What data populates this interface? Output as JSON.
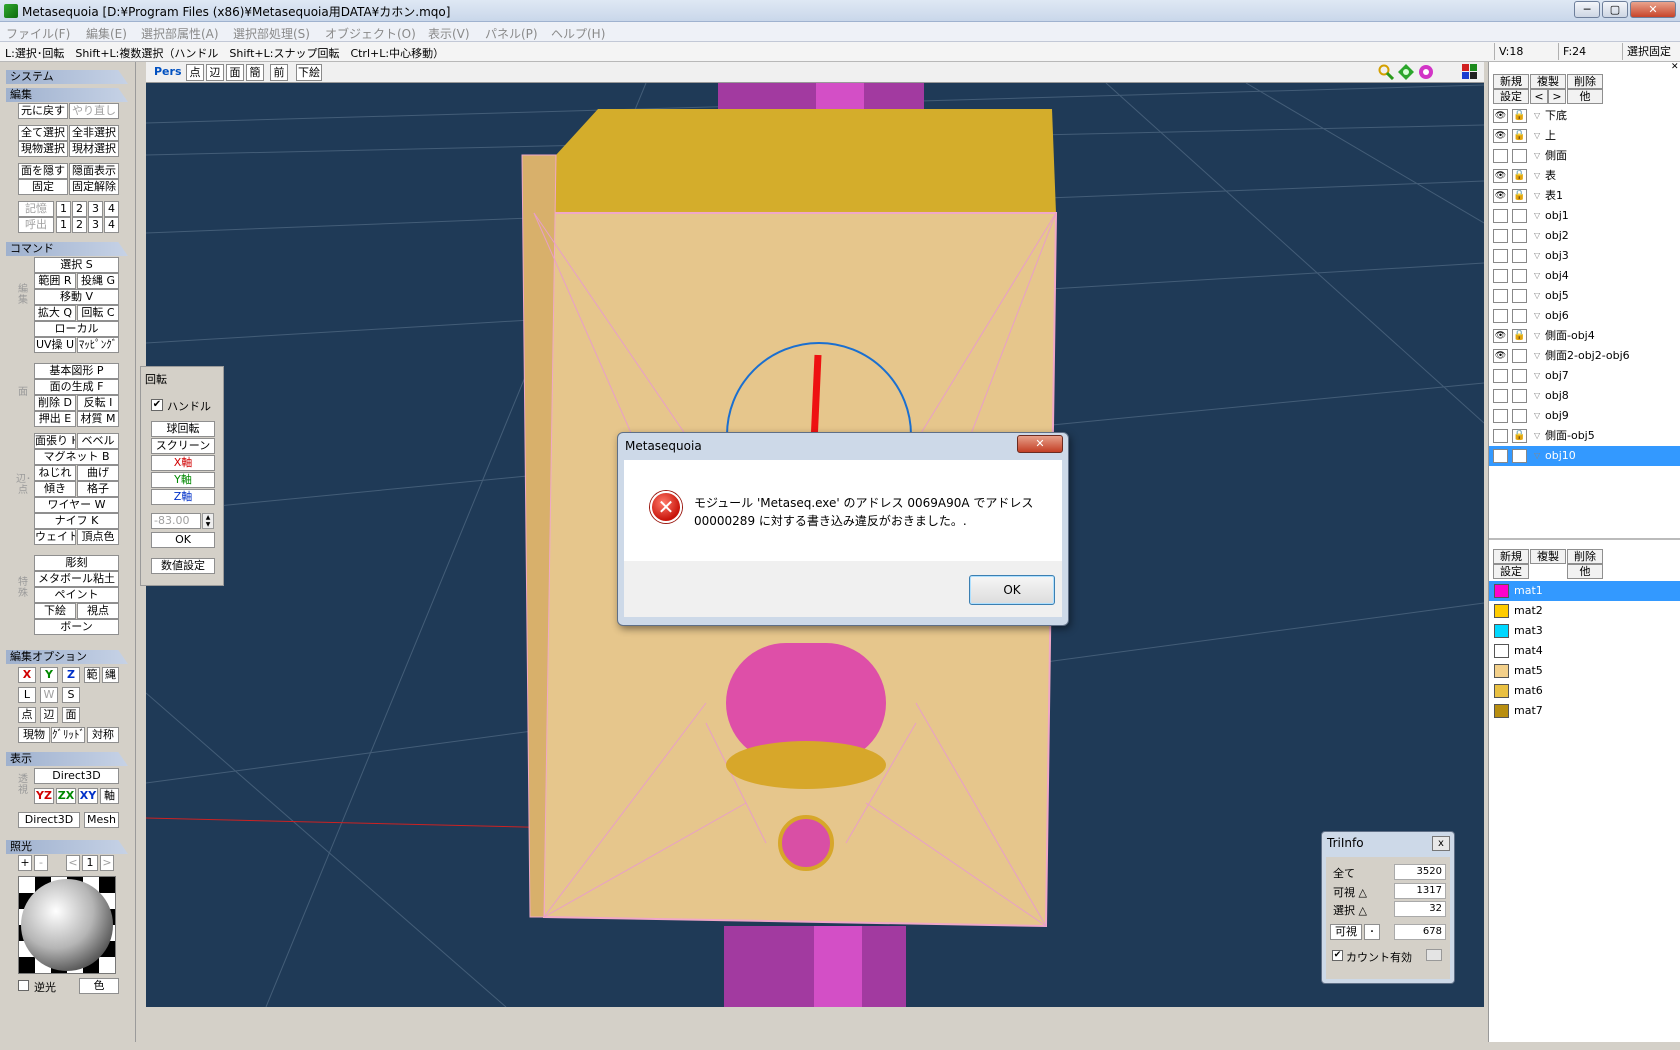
{
  "window": {
    "title": "Metasequoia [D:¥Program Files (x86)¥Metasequoia用DATA¥カホン.mqo]",
    "controls": [
      "─",
      "▢",
      "✕"
    ]
  },
  "menu": [
    "ファイル(F)",
    "編集(E)",
    "選択部属性(A)",
    "選択部処理(S)",
    "オブジェクト(O)",
    "表示(V)",
    "パネル(P)",
    "ヘルプ(H)"
  ],
  "status": {
    "hint": "L:選択･回転　Shift+L:複数選択（ハンドル　Shift+L:スナップ回転　Ctrl+L:中心移動）",
    "vertices": "V:18",
    "faces": "F:24",
    "mode": "選択固定"
  },
  "left": {
    "system": "システム",
    "edit": "編集",
    "undo": "元に戻す",
    "redo": "やり直し",
    "select_all": "全て選択",
    "deselect_all": "全非選択",
    "select_obj": "現物選択",
    "select_mat": "現材選択",
    "hide_face": "面を隠す",
    "hidden_show": "隠面表示",
    "fix": "固定",
    "unfix": "固定解除",
    "memory": "記憶",
    "recall": "呼出",
    "slots": [
      "1",
      "2",
      "3",
      "4"
    ],
    "command": "コマンド",
    "basic_label": "編集",
    "select_s": "選択 S",
    "range_r": "範囲 R",
    "lasso_g": "投縄 G",
    "move_v": "移動 V",
    "scale_q": "拡大 Q",
    "rotate_c": "回転 C",
    "local": "ローカル",
    "uv_u": "UV操 U",
    "mapping": "ﾏｯﾋﾟﾝｸﾞ",
    "face_label": "面",
    "basic_shape": "基本図形 P",
    "face_gen": "面の生成 F",
    "delete_d": "削除 D",
    "flip_i": "反転 I",
    "extrude_e": "押出 E",
    "material_m": "材質 M",
    "edge_label": "辺･点",
    "paste_h": "面張り H",
    "bevel": "ベベル",
    "magnet_b": "マグネット B",
    "twist": "ねじれ",
    "bend": "曲げ",
    "tilt": "傾き",
    "lattice": "格子",
    "wire_w": "ワイヤー W",
    "knife_k": "ナイフ K",
    "weight": "ウェイト",
    "vertex_color": "頂点色",
    "special_label": "特殊",
    "sculpt": "彫刻",
    "metaball": "メタボール粘土",
    "paint": "ペイント",
    "underlay": "下絵",
    "viewpoint": "視点",
    "bone": "ボーン",
    "edit_option": "編集オプション",
    "axis_x": "X",
    "axis_y": "Y",
    "axis_z": "Z",
    "opt_range": "範",
    "opt_lasso": "縄",
    "opt_l": "L",
    "opt_w": "W",
    "opt_s": "S",
    "opt_point": "点",
    "opt_edge": "辺",
    "opt_face": "面",
    "opt_current": "現物",
    "opt_grid": "ｸﾞﾘｯﾄﾞ",
    "opt_sym": "対称",
    "display": "表示",
    "disp_label": "透視",
    "direct3d": "Direct3D",
    "yz": "YZ",
    "zx": "ZX",
    "xy": "XY",
    "axis": "軸",
    "direct3d2": "Direct3D",
    "mesh": "Mesh",
    "light": "照光",
    "plus": "+",
    "minus": "-",
    "prev": "<",
    "light_num": "1",
    "next": ">",
    "reverse_light": "逆光",
    "color": "色"
  },
  "viewtoolbar": [
    "Pers",
    "点",
    "辺",
    "面",
    "簡",
    "前",
    "下絵"
  ],
  "rotation": {
    "title": "回転",
    "handle": "ハンドル",
    "sphere": "球回転",
    "screen": "スクリーン",
    "x_axis": "X軸",
    "y_axis": "Y軸",
    "z_axis": "Z軸",
    "value": "-83.00",
    "ok": "OK",
    "numeric": "数値設定"
  },
  "objects_panel": {
    "buttons": [
      "新規",
      "複製",
      "削除",
      "設定",
      "<",
      ">",
      "他"
    ],
    "items": [
      {
        "name": "下底",
        "visible": true,
        "locked": true
      },
      {
        "name": "上",
        "visible": true,
        "locked": true
      },
      {
        "name": "側面",
        "visible": false,
        "locked": false
      },
      {
        "name": "表",
        "visible": true,
        "locked": true
      },
      {
        "name": "表1",
        "visible": true,
        "locked": true
      },
      {
        "name": "obj1",
        "visible": false,
        "locked": false
      },
      {
        "name": "obj2",
        "visible": false,
        "locked": false
      },
      {
        "name": "obj3",
        "visible": false,
        "locked": false
      },
      {
        "name": "obj4",
        "visible": false,
        "locked": false
      },
      {
        "name": "obj5",
        "visible": false,
        "locked": false
      },
      {
        "name": "obj6",
        "visible": false,
        "locked": false
      },
      {
        "name": "側面-obj4",
        "visible": true,
        "locked": true
      },
      {
        "name": "側面2-obj2-obj6",
        "visible": true,
        "locked": false
      },
      {
        "name": "obj7",
        "visible": false,
        "locked": false
      },
      {
        "name": "obj8",
        "visible": false,
        "locked": false
      },
      {
        "name": "obj9",
        "visible": false,
        "locked": false
      },
      {
        "name": "側面-obj5",
        "visible": false,
        "locked": true
      },
      {
        "name": "obj10",
        "visible": true,
        "locked": false
      }
    ]
  },
  "materials_panel": {
    "buttons": [
      "新規",
      "複製",
      "削除",
      "設定",
      "他"
    ],
    "items": [
      {
        "name": "mat1",
        "color": "#ff00cc"
      },
      {
        "name": "mat2",
        "color": "#ffcc00"
      },
      {
        "name": "mat3",
        "color": "#00d8ff"
      },
      {
        "name": "mat4",
        "color": "#ffffff"
      },
      {
        "name": "mat5",
        "color": "#f3d08a"
      },
      {
        "name": "mat6",
        "color": "#e9c042"
      },
      {
        "name": "mat7",
        "color": "#b88e10"
      }
    ]
  },
  "dialog": {
    "title": "Metasequoia",
    "close": "✕",
    "message": "モジュール 'Metaseq.exe' のアドレス 0069A90A でアドレス 00000289 に対する書き込み違反がおきました。.",
    "ok": "OK"
  },
  "triinfo": {
    "title": "TriInfo",
    "close": "x",
    "all_label": "全て",
    "all_value": "3520",
    "visible_label": "可視 △",
    "visible_value": "1317",
    "selected_label": "選択 △",
    "selected_value": "32",
    "visible2_label": "可視",
    "dot": "･",
    "visible2_value": "678",
    "count_enabled": "カウント有効"
  }
}
